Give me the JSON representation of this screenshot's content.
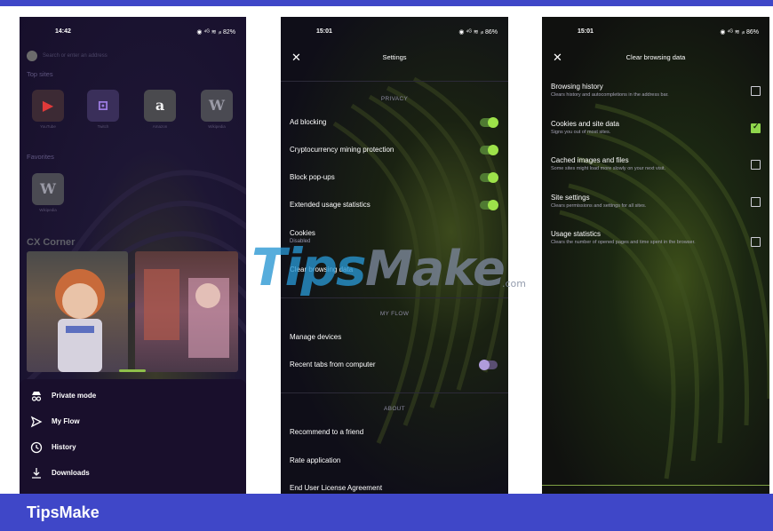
{
  "brand": "TipsMake",
  "watermark": {
    "tips": "Tips",
    "make": "Make",
    "com": ".com"
  },
  "phone1": {
    "time": "14:42",
    "status_icons": "◉ ⁴ᴳ ≋ ᵢₗₗ 82%",
    "search_placeholder": "Search or enter an address",
    "top_sites_label": "Top sites",
    "top_sites": [
      {
        "name": "YouTube",
        "glyph": "▶",
        "bg": "#3c2a34",
        "fg": "#e03a3a"
      },
      {
        "name": "Twitch",
        "glyph": "⊡",
        "bg": "#3a2f5a",
        "fg": "#9b7be0"
      },
      {
        "name": "Amazon",
        "glyph": "a",
        "bg": "#4a4a4e",
        "fg": "#f1f1f1"
      },
      {
        "name": "Wikipedia",
        "glyph": "W",
        "bg": "#4a4a52",
        "fg": "#9a9aa6"
      }
    ],
    "favorites_label": "Favorites",
    "favorites": [
      {
        "name": "Wikipedia",
        "glyph": "W",
        "bg": "#4a4a52",
        "fg": "#9a9aa6"
      }
    ],
    "cx_corner": "CX Corner",
    "menu": [
      {
        "icon": "private-mode-icon",
        "label": "Private mode"
      },
      {
        "icon": "flow-icon",
        "label": "My Flow"
      },
      {
        "icon": "history-icon",
        "label": "History"
      },
      {
        "icon": "download-icon",
        "label": "Downloads"
      }
    ]
  },
  "phone2": {
    "time": "15:01",
    "status_icons": "◉ ⁴ᴳ ≋ ᵢₗₗ 86%",
    "title": "Settings",
    "privacy_header": "PRIVACY",
    "privacy_items": [
      {
        "label": "Ad blocking",
        "toggle": "on"
      },
      {
        "label": "Cryptocurrency mining protection",
        "toggle": "on"
      },
      {
        "label": "Block pop-ups",
        "toggle": "on"
      },
      {
        "label": "Extended usage statistics",
        "toggle": "on"
      }
    ],
    "cookies_label": "Cookies",
    "cookies_sub": "Disabled",
    "clear_data_label": "Clear browsing data",
    "myflow_header": "MY FLOW",
    "manage_devices": "Manage devices",
    "recent_tabs": "Recent tabs from computer",
    "recent_tabs_toggle": "off",
    "about_header": "ABOUT",
    "recommend": "Recommend to a friend",
    "rate": "Rate application",
    "eula": "End User License Agreement"
  },
  "phone3": {
    "time": "15:01",
    "status_icons": "◉ ⁴ᴳ ≋ ᵢₗₗ 86%",
    "title": "Clear browsing data",
    "items": [
      {
        "label": "Browsing history",
        "sub": "Clears history and autocompletions in the address bar.",
        "checked": false
      },
      {
        "label": "Cookies and site data",
        "sub": "Signs you out of most sites.",
        "checked": true
      },
      {
        "label": "Cached images and files",
        "sub": "Some sites might load more slowly on your next visit.",
        "checked": false
      },
      {
        "label": "Site settings",
        "sub": "Clears permissions and settings for all sites.",
        "checked": false
      },
      {
        "label": "Usage statistics",
        "sub": "Clears the number of opened pages and time spent in the browser.",
        "checked": false
      }
    ]
  }
}
